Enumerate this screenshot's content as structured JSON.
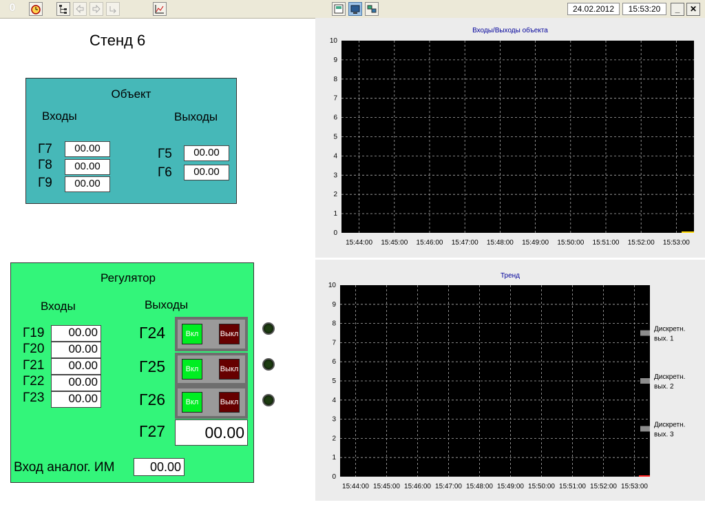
{
  "toolbar": {
    "counter": "0",
    "date": "24.02.2012",
    "time": "15:53:20",
    "minimize": "_",
    "close": "✕",
    "icons": [
      "clock-icon",
      "tree-icon",
      "back-arrow-icon",
      "forward-arrow-icon",
      "return-icon",
      "trend-icon",
      "screen-icon",
      "monitor-icon",
      "network-icon"
    ]
  },
  "title": "Стенд 6",
  "object": {
    "title": "Объект",
    "inputs_label": "Входы",
    "outputs_label": "Выходы",
    "inputs": [
      {
        "name": "Г7",
        "value": "00.00"
      },
      {
        "name": "Г8",
        "value": "00.00"
      },
      {
        "name": "Г9",
        "value": "00.00"
      }
    ],
    "outputs": [
      {
        "name": "Г5",
        "value": "00.00"
      },
      {
        "name": "Г6",
        "value": "00.00"
      }
    ]
  },
  "regulator": {
    "title": "Регулятор",
    "inputs_label": "Входы",
    "outputs_label": "Выходы",
    "inputs": [
      {
        "name": "Г19",
        "value": "00.00"
      },
      {
        "name": "Г20",
        "value": "00.00"
      },
      {
        "name": "Г21",
        "value": "00.00"
      },
      {
        "name": "Г22",
        "value": "00.00"
      },
      {
        "name": "Г23",
        "value": "00.00"
      }
    ],
    "outputs": [
      {
        "name": "Г24",
        "on_label": "Вкл",
        "off_label": "Выкл"
      },
      {
        "name": "Г25",
        "on_label": "Вкл",
        "off_label": "Выкл"
      },
      {
        "name": "Г26",
        "on_label": "Вкл",
        "off_label": "Выкл"
      }
    ],
    "g27": {
      "name": "Г27",
      "value": "00.00"
    },
    "analog": {
      "label": "Вход аналог. ИМ",
      "value": "00.00"
    }
  },
  "colors": {
    "object_panel": "#46b8b8",
    "regulator_panel": "#33f57a",
    "chart_bg": "#000000",
    "grid": "#b0b0b0",
    "button_on": "#00ee22",
    "button_off": "#660000"
  },
  "chart_data": [
    {
      "type": "line",
      "title": "Входы/Выходы объекта",
      "x": [
        "15:44:00",
        "15:45:00",
        "15:46:00",
        "15:47:00",
        "15:48:00",
        "15:49:00",
        "15:50:00",
        "15:51:00",
        "15:52:00",
        "15:53:00"
      ],
      "ylim": [
        0,
        10
      ],
      "yticks": [
        0,
        1,
        2,
        3,
        4,
        5,
        6,
        7,
        8,
        9,
        10
      ],
      "grid": true,
      "series": [
        {
          "color": "#ffd800",
          "values": [
            0,
            0,
            0,
            0,
            0,
            0,
            0,
            0,
            0,
            0
          ]
        }
      ]
    },
    {
      "type": "line",
      "title": "Тренд",
      "x": [
        "15:44:00",
        "15:45:00",
        "15:46:00",
        "15:47:00",
        "15:48:00",
        "15:49:00",
        "15:50:00",
        "15:51:00",
        "15:52:00",
        "15:53:00"
      ],
      "ylim": [
        0,
        10
      ],
      "yticks": [
        0,
        1,
        2,
        3,
        4,
        5,
        6,
        7,
        8,
        9,
        10
      ],
      "grid": true,
      "legend": "right",
      "series": [
        {
          "name": "Дискретн. вых. 1",
          "level": 7.5,
          "color": "#8c8c8c"
        },
        {
          "name": "Дискретн. вых. 2",
          "level": 5.0,
          "color": "#8c8c8c"
        },
        {
          "name": "Дискретн. вых. 3",
          "level": 2.5,
          "color": "#8c8c8c"
        }
      ]
    }
  ]
}
